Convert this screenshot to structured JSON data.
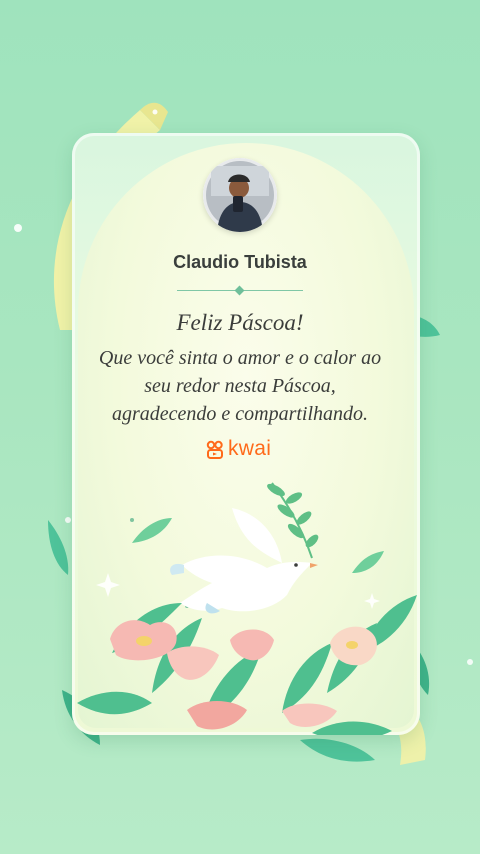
{
  "profile": {
    "name": "Claudio Tubista"
  },
  "greeting": {
    "title": "Feliz Páscoa!",
    "lines": [
      "Que você sinta o amor e o calor ao",
      "seu redor nesta Páscoa,",
      "agradecendo e compartilhando."
    ]
  },
  "brand": {
    "name": "kwai",
    "color": "#ff6a1a"
  },
  "colors": {
    "background": "#a9e6c0",
    "card": "#eafbe1",
    "ribbon": "#f5f3a8",
    "leaf": "#4fbf8f",
    "flower": "#f6b7b0"
  }
}
